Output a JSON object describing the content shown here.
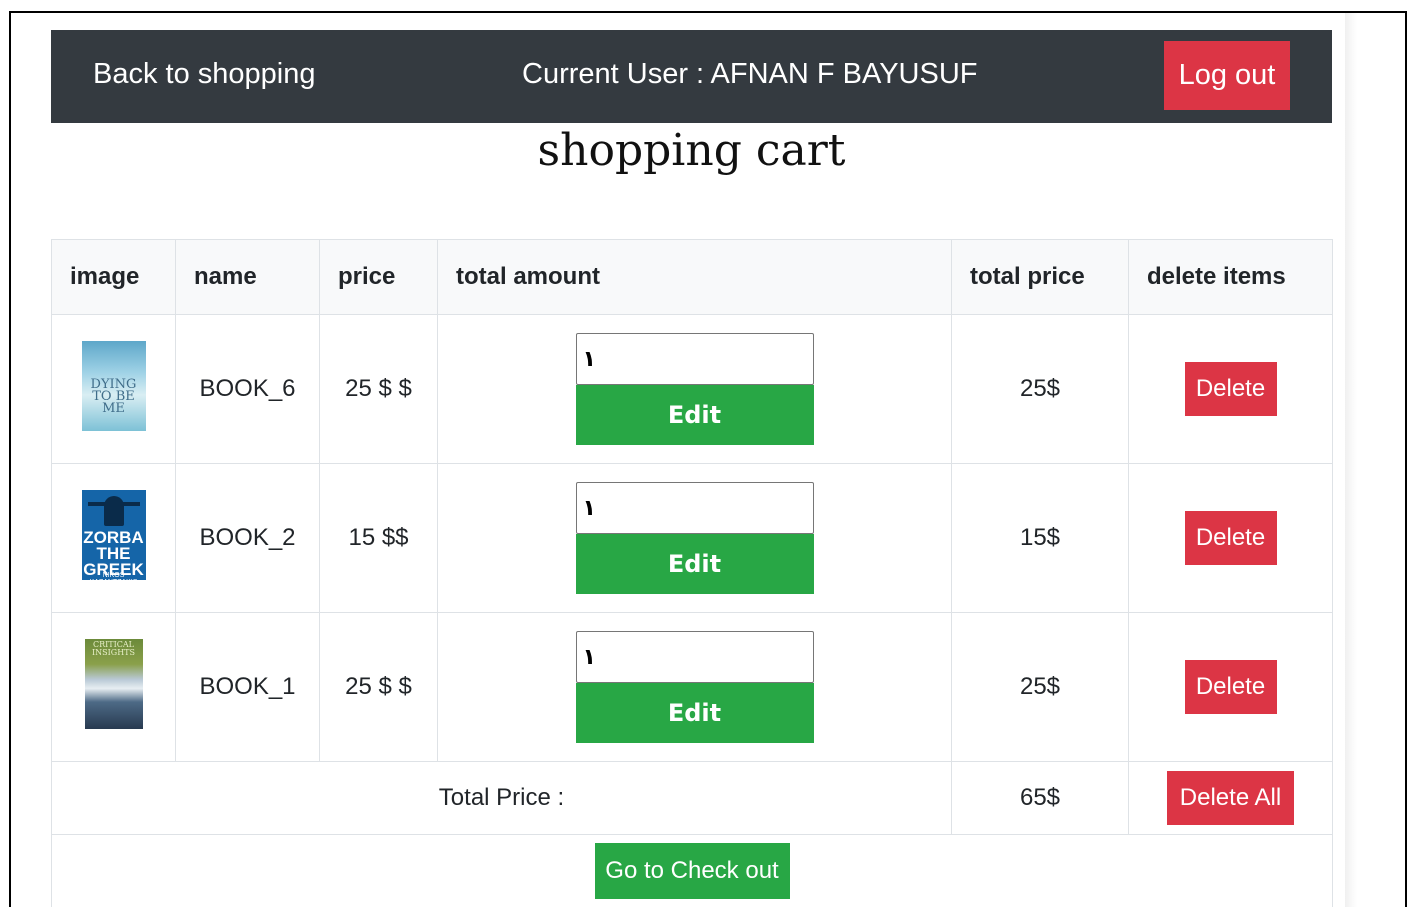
{
  "navbar": {
    "back_label": "Back to shopping",
    "current_user": "Current User : AFNAN F BAYUSUF",
    "logout_label": "Log out"
  },
  "page_title": "shopping cart",
  "table": {
    "headers": [
      "image",
      "name",
      "price",
      "total amount",
      "total price",
      "delete items"
    ],
    "rows": [
      {
        "cover_text": "DYING TO BE ME",
        "name": "BOOK_6",
        "price": "25 $ $",
        "amount": "١",
        "edit_label": "Edit",
        "total": "25$",
        "delete_label": "Delete"
      },
      {
        "cover_text": "ZORBA THE GREEK",
        "cover_sub": "NIKOS KAZANTZAKIS",
        "name": "BOOK_2",
        "price": "15 $$",
        "amount": "١",
        "edit_label": "Edit",
        "total": "15$",
        "delete_label": "Delete"
      },
      {
        "cover_text": "CRITICAL INSIGHTS",
        "name": "BOOK_1",
        "price": "25 $ $",
        "amount": "١",
        "edit_label": "Edit",
        "total": "25$",
        "delete_label": "Delete"
      }
    ],
    "total_label": "Total Price :",
    "grand_total": "65$",
    "delete_all_label": "Delete All",
    "checkout_label": "Go to Check out"
  },
  "colors": {
    "navbar_bg": "#343a40",
    "danger": "#dc3545",
    "success": "#28a745",
    "header_bg": "#f8f9fa",
    "border": "#dee2e6"
  }
}
